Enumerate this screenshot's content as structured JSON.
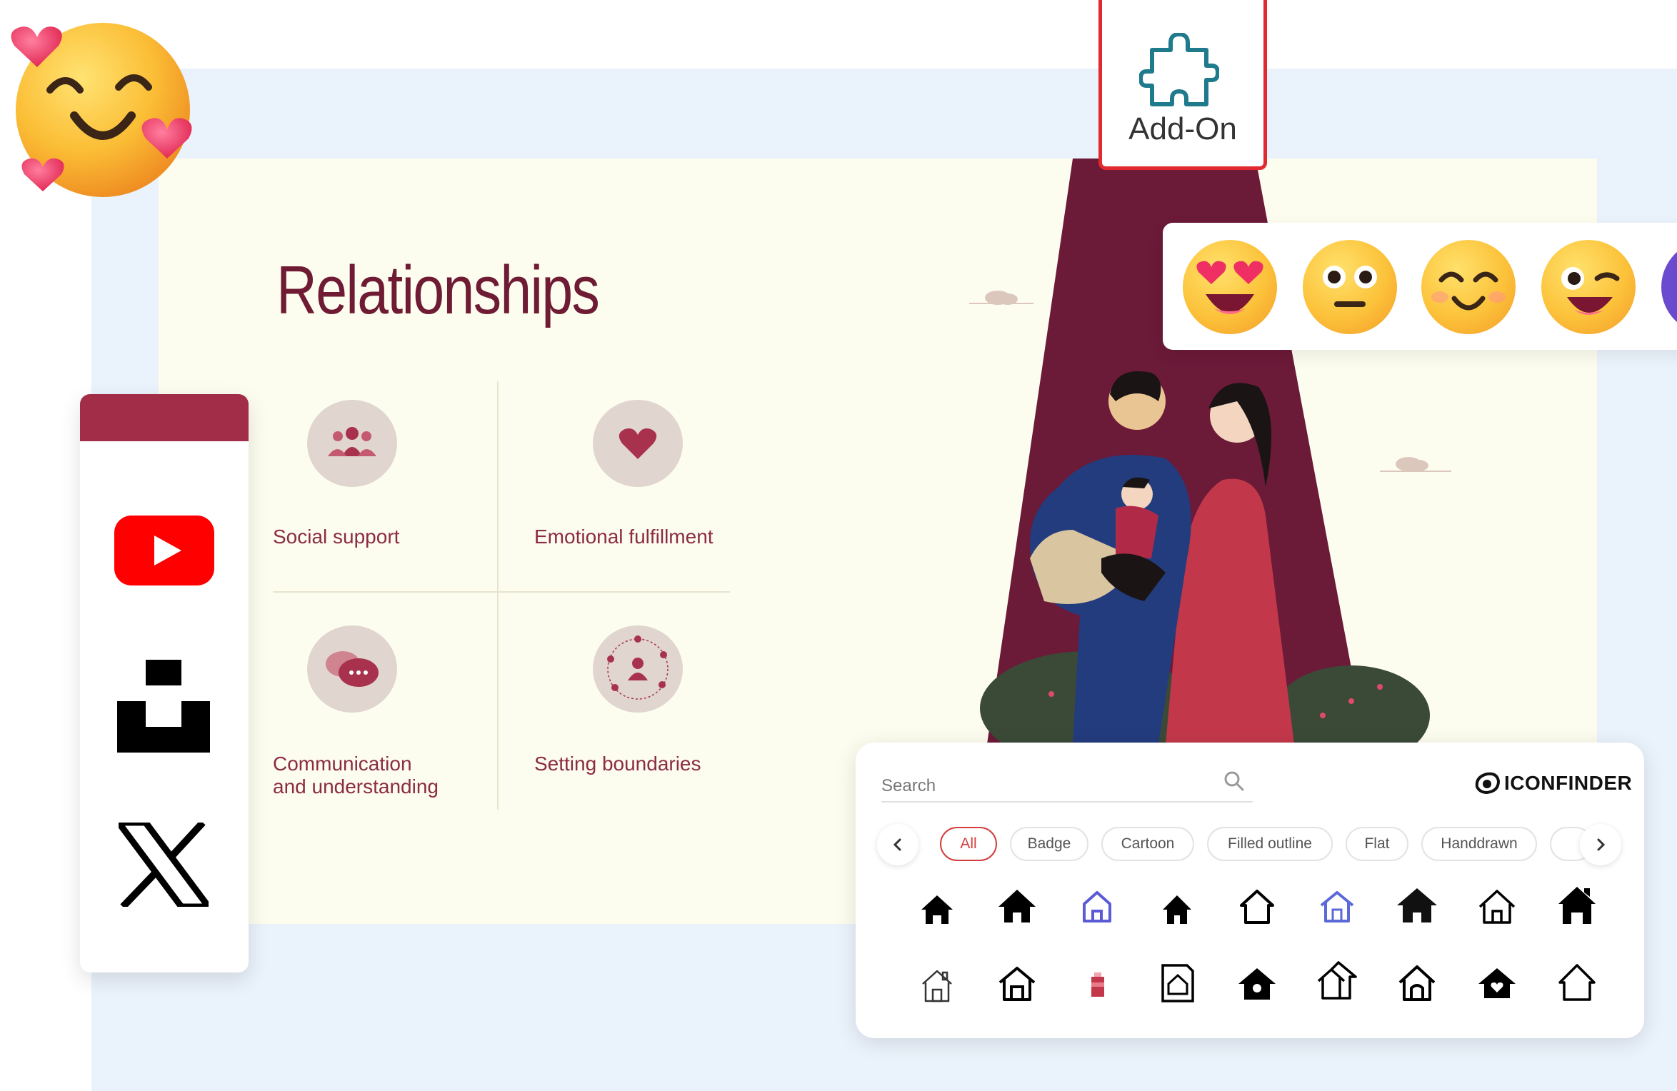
{
  "slide": {
    "title": "Relationships",
    "items": [
      {
        "label": "Social support",
        "icon": "people-group-icon"
      },
      {
        "label": "Emotional fulfillment",
        "icon": "heart-icon"
      },
      {
        "label_line1": "Communication",
        "label_line2": "and understanding",
        "icon": "chat-bubbles-icon"
      },
      {
        "label": "Setting boundaries",
        "icon": "person-boundary-icon"
      }
    ],
    "colors": {
      "title": "#6e1b33",
      "label": "#8b2b44",
      "background": "#fdfdef",
      "accent": "#6b1a38"
    }
  },
  "addon": {
    "label": "Add-On",
    "icon": "puzzle-piece-icon",
    "highlight_color": "#e12a2f"
  },
  "emoji_panel": {
    "emojis": [
      "heart-eyes-emoji",
      "neutral-face-emoji",
      "smiling-face-emoji",
      "winking-face-emoji"
    ]
  },
  "social_panel": {
    "items": [
      "youtube-logo",
      "unsplash-logo",
      "x-logo"
    ],
    "header_color": "#a22d48"
  },
  "iconfinder": {
    "search_placeholder": "Search",
    "brand": "ICONFINDER",
    "filters": [
      "All",
      "Badge",
      "Cartoon",
      "Filled outline",
      "Flat",
      "Handdrawn"
    ],
    "active_filter": "All",
    "icon_subject": "home-icon"
  }
}
